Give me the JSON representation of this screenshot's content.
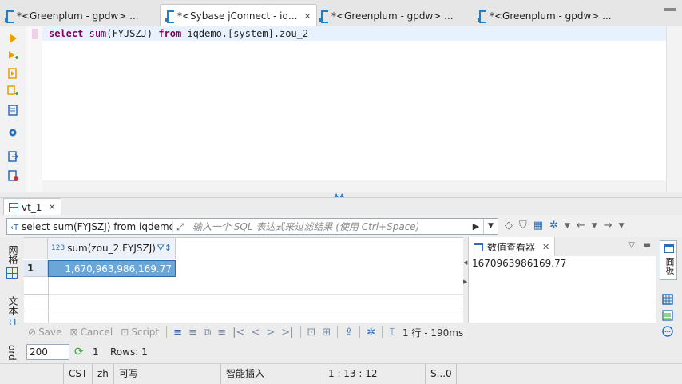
{
  "tabs": [
    {
      "label": "*<Greenplum - gpdw> ...",
      "active": false
    },
    {
      "label": "*<Sybase jConnect - iq...",
      "active": true
    },
    {
      "label": "*<Greenplum - gpdw> ...",
      "active": false
    },
    {
      "label": "*<Greenplum - gpdw> ...",
      "active": false
    }
  ],
  "tab_close_glyph": "✕",
  "editor": {
    "kw_select": "select",
    "fn_sum": "sum",
    "arg": "(FYJSZJ) ",
    "kw_from": "from",
    "rest": " iqdemo.[system].zou_2"
  },
  "results_tab": {
    "label": "vt_1",
    "close": "✕"
  },
  "filter": {
    "query_prefix": "‹T",
    "query_text": "select sum(FYJSZJ) from iqdemo",
    "placeholder": "输入一个 SQL 表达式来过滤结果 (使用 Ctrl+Space)"
  },
  "side_labels": {
    "grid": "网格",
    "text": "文本",
    "record": "ord"
  },
  "grid": {
    "column_type_badge": "123",
    "column_header": "sum(zou_2.FYJSZJ)",
    "rows": [
      {
        "num": "1",
        "value": "1,670,963,986,169.77"
      }
    ]
  },
  "value_viewer": {
    "title": "数值查看器",
    "close": "✕",
    "value": "1670963986169.77"
  },
  "right_panel_label": "面板",
  "toolbar": {
    "save": "Save",
    "cancel": "Cancel",
    "script": "Script",
    "rows_time": "1 行 - 190ms"
  },
  "limit": {
    "value": "200",
    "fetched": "1",
    "rows_label": "Rows: 1"
  },
  "status": {
    "tz": "CST",
    "lang": "zh",
    "mode": "可写",
    "insert": "智能插入",
    "pos": "1 : 13 : 12",
    "sel": "S...0"
  },
  "colors": {
    "accent": "#2a6ebb",
    "selected_cell": "#6ba6d8",
    "keyword": "#7f0055",
    "current_line": "#e8f2fe"
  }
}
